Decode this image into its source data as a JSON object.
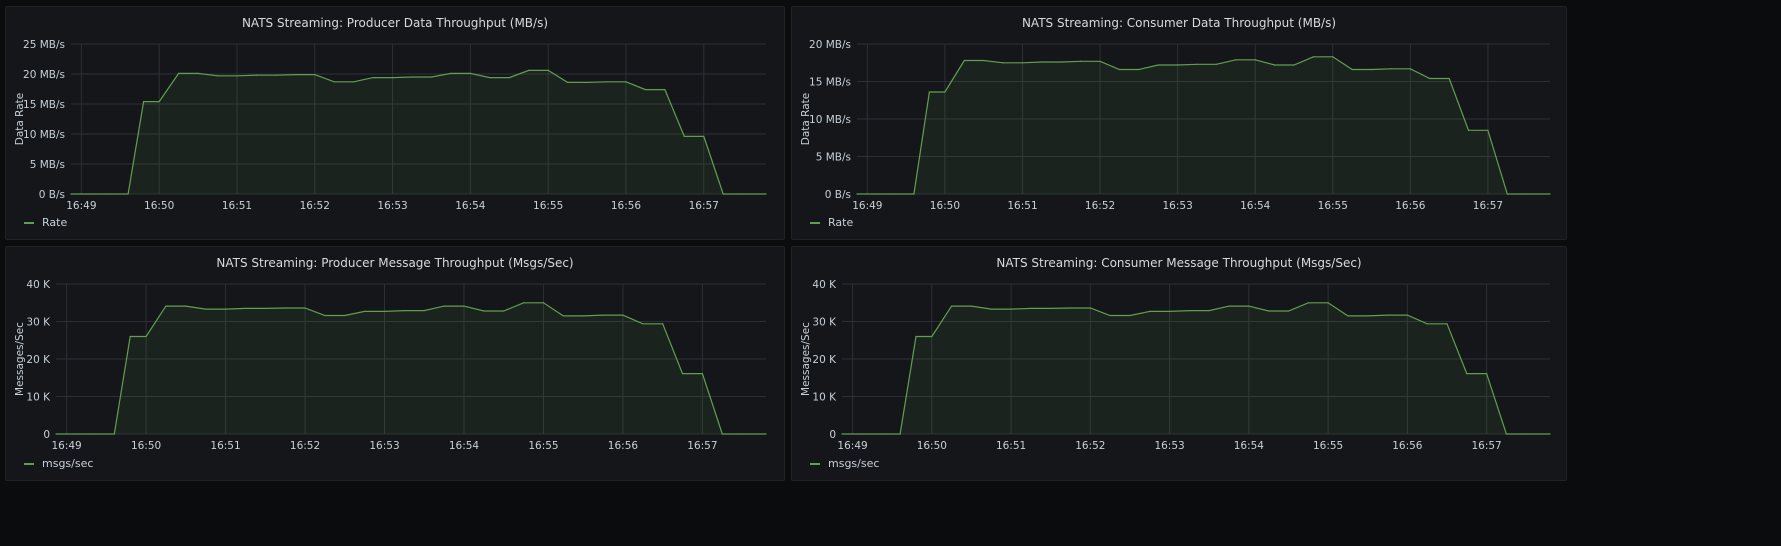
{
  "colors": {
    "series": "#629e51",
    "fill": "rgba(98,158,81,0.10)",
    "grid": "#2c3035",
    "tick": "#c7d0d9"
  },
  "x_ticks": [
    "16:49",
    "16:50",
    "16:51",
    "16:52",
    "16:53",
    "16:54",
    "16:55",
    "16:56",
    "16:57"
  ],
  "chart_data": [
    {
      "type": "area",
      "title": "NATS Streaming: Producer Data Throughput (MB/s)",
      "ylabel": "Data Rate",
      "legend": "Rate",
      "ylim": [
        0,
        25
      ],
      "y_ticks": [
        "0 B/s",
        "5 MB/s",
        "10 MB/s",
        "15 MB/s",
        "20 MB/s",
        "25 MB/s"
      ],
      "x_range": [
        "16:48:52",
        "16:57:48"
      ],
      "series": [
        {
          "name": "Rate",
          "x": [
            "16:48:52",
            "16:49:06",
            "16:49:21",
            "16:49:36",
            "16:49:48",
            "16:50:00",
            "16:50:15",
            "16:50:30",
            "16:50:45",
            "16:51:00",
            "16:51:15",
            "16:51:30",
            "16:51:45",
            "16:52:00",
            "16:52:15",
            "16:52:30",
            "16:52:45",
            "16:53:00",
            "16:53:15",
            "16:53:30",
            "16:53:45",
            "16:54:00",
            "16:54:15",
            "16:54:30",
            "16:54:45",
            "16:55:00",
            "16:55:15",
            "16:55:30",
            "16:55:45",
            "16:56:00",
            "16:56:15",
            "16:56:30",
            "16:56:45",
            "16:57:00",
            "16:57:15",
            "16:57:30",
            "16:57:48"
          ],
          "values": [
            0,
            0,
            0,
            0,
            15.4,
            15.4,
            20.1,
            20.1,
            19.7,
            19.7,
            19.8,
            19.8,
            19.9,
            19.9,
            18.7,
            18.7,
            19.4,
            19.4,
            19.5,
            19.5,
            20.1,
            20.1,
            19.4,
            19.4,
            20.6,
            20.6,
            18.6,
            18.6,
            18.7,
            18.7,
            17.4,
            17.4,
            9.6,
            9.6,
            0,
            0,
            0
          ]
        }
      ]
    },
    {
      "type": "area",
      "title": "NATS Streaming: Consumer Data Throughput (MB/s)",
      "ylabel": "Data Rate",
      "legend": "Rate",
      "ylim": [
        0,
        20
      ],
      "y_ticks": [
        "0 B/s",
        "5 MB/s",
        "10 MB/s",
        "15 MB/s",
        "20 MB/s"
      ],
      "x_range": [
        "16:48:52",
        "16:57:48"
      ],
      "series": [
        {
          "name": "Rate",
          "x": [
            "16:48:52",
            "16:49:06",
            "16:49:21",
            "16:49:36",
            "16:49:48",
            "16:50:00",
            "16:50:15",
            "16:50:30",
            "16:50:45",
            "16:51:00",
            "16:51:15",
            "16:51:30",
            "16:51:45",
            "16:52:00",
            "16:52:15",
            "16:52:30",
            "16:52:45",
            "16:53:00",
            "16:53:15",
            "16:53:30",
            "16:53:45",
            "16:54:00",
            "16:54:15",
            "16:54:30",
            "16:54:45",
            "16:55:00",
            "16:55:15",
            "16:55:30",
            "16:55:45",
            "16:56:00",
            "16:56:15",
            "16:56:30",
            "16:56:45",
            "16:57:00",
            "16:57:15",
            "16:57:30",
            "16:57:48"
          ],
          "values": [
            0,
            0,
            0,
            0,
            13.6,
            13.6,
            17.8,
            17.8,
            17.5,
            17.5,
            17.6,
            17.6,
            17.7,
            17.7,
            16.6,
            16.6,
            17.2,
            17.2,
            17.3,
            17.3,
            17.9,
            17.9,
            17.2,
            17.2,
            18.3,
            18.3,
            16.6,
            16.6,
            16.7,
            16.7,
            15.4,
            15.4,
            8.5,
            8.5,
            0,
            0,
            0
          ]
        }
      ]
    },
    {
      "type": "area",
      "title": "NATS Streaming: Producer Message Throughput (Msgs/Sec)",
      "ylabel": "Messages/Sec",
      "legend": "msgs/sec",
      "ylim": [
        0,
        40000
      ],
      "y_ticks": [
        "0",
        "10 K",
        "20 K",
        "30 K",
        "40 K"
      ],
      "x_range": [
        "16:48:52",
        "16:57:48"
      ],
      "series": [
        {
          "name": "msgs/sec",
          "x": [
            "16:48:52",
            "16:49:06",
            "16:49:21",
            "16:49:36",
            "16:49:48",
            "16:50:00",
            "16:50:15",
            "16:50:30",
            "16:50:45",
            "16:51:00",
            "16:51:15",
            "16:51:30",
            "16:51:45",
            "16:52:00",
            "16:52:15",
            "16:52:30",
            "16:52:45",
            "16:53:00",
            "16:53:15",
            "16:53:30",
            "16:53:45",
            "16:54:00",
            "16:54:15",
            "16:54:30",
            "16:54:45",
            "16:55:00",
            "16:55:15",
            "16:55:30",
            "16:55:45",
            "16:56:00",
            "16:56:15",
            "16:56:30",
            "16:56:45",
            "16:57:00",
            "16:57:15",
            "16:57:30",
            "16:57:48"
          ],
          "values": [
            0,
            0,
            0,
            0,
            26000,
            26000,
            34100,
            34100,
            33300,
            33300,
            33500,
            33500,
            33600,
            33600,
            31600,
            31600,
            32700,
            32700,
            32900,
            32900,
            34100,
            34100,
            32800,
            32800,
            35000,
            35000,
            31500,
            31500,
            31700,
            31700,
            29400,
            29400,
            16100,
            16100,
            0,
            0,
            0
          ]
        }
      ]
    },
    {
      "type": "area",
      "title": "NATS Streaming: Consumer Message Throughput (Msgs/Sec)",
      "ylabel": "Messages/Sec",
      "legend": "msgs/sec",
      "ylim": [
        0,
        40000
      ],
      "y_ticks": [
        "0",
        "10 K",
        "20 K",
        "30 K",
        "40 K"
      ],
      "x_range": [
        "16:48:52",
        "16:57:48"
      ],
      "series": [
        {
          "name": "msgs/sec",
          "x": [
            "16:48:52",
            "16:49:06",
            "16:49:21",
            "16:49:36",
            "16:49:48",
            "16:50:00",
            "16:50:15",
            "16:50:30",
            "16:50:45",
            "16:51:00",
            "16:51:15",
            "16:51:30",
            "16:51:45",
            "16:52:00",
            "16:52:15",
            "16:52:30",
            "16:52:45",
            "16:53:00",
            "16:53:15",
            "16:53:30",
            "16:53:45",
            "16:54:00",
            "16:54:15",
            "16:54:30",
            "16:54:45",
            "16:55:00",
            "16:55:15",
            "16:55:30",
            "16:55:45",
            "16:56:00",
            "16:56:15",
            "16:56:30",
            "16:56:45",
            "16:57:00",
            "16:57:15",
            "16:57:30",
            "16:57:48"
          ],
          "values": [
            0,
            0,
            0,
            0,
            26000,
            26000,
            34100,
            34100,
            33300,
            33300,
            33500,
            33500,
            33600,
            33600,
            31600,
            31600,
            32700,
            32700,
            32900,
            32900,
            34100,
            34100,
            32800,
            32800,
            35000,
            35000,
            31500,
            31500,
            31700,
            31700,
            29400,
            29400,
            16100,
            16100,
            0,
            0,
            0
          ]
        }
      ]
    }
  ]
}
